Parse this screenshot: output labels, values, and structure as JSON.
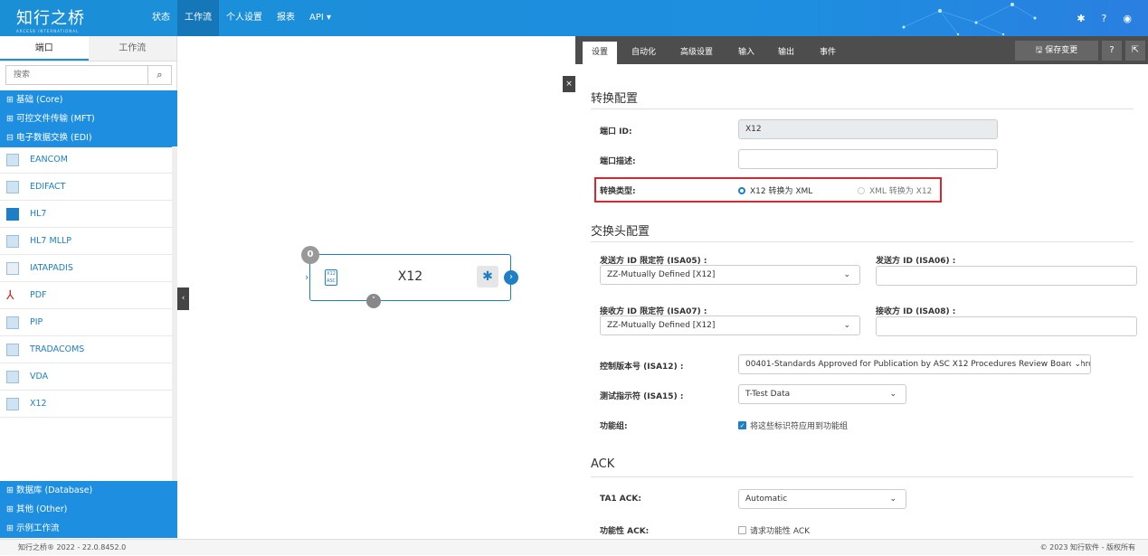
{
  "header": {
    "logo": "知行之桥",
    "logo_sub": "ARCESB INTERNATIONAL",
    "nav": [
      "状态",
      "工作流",
      "个人设置",
      "报表",
      "API ▾"
    ],
    "active_nav": 1
  },
  "sidebar": {
    "tabs": [
      "端口",
      "工作流"
    ],
    "search_placeholder": "搜索",
    "groups": {
      "core": "⊞ 基础 (Core)",
      "mft": "⊞ 可控文件传输 (MFT)",
      "edi": "⊟ 电子数据交换 (EDI)",
      "database": "⊞ 数据库 (Database)",
      "other": "⊞ 其他 (Other)",
      "examples": "⊞ 示例工作流"
    },
    "ports": [
      "EANCOM",
      "EDIFACT",
      "HL7",
      "HL7 MLLP",
      "IATAPADIS",
      "PDF",
      "PIP",
      "TRADACOMS",
      "VDA",
      "X12"
    ]
  },
  "canvas": {
    "node_title": "X12",
    "node_badge": "0",
    "node_icon_text": "X12 ASC"
  },
  "panel": {
    "tabs": [
      "设置",
      "自动化",
      "高级设置",
      "输入",
      "输出",
      "事件"
    ],
    "save_label": "🖫 保存变更",
    "sections": {
      "translation": "转换配置",
      "interchange": "交换头配置",
      "ack": "ACK"
    },
    "fields": {
      "port_id_label": "端口 ID:",
      "port_id_value": "X12",
      "port_desc_label": "端口描述:",
      "type_label": "转换类型:",
      "radio_x12_xml": "X12 转换为 XML",
      "radio_xml_x12": "XML 转换为 X12",
      "sender_qual_label": "发送方 ID 限定符 (ISA05) :",
      "sender_qual_value": "ZZ-Mutually Defined [X12]",
      "sender_id_label": "发送方 ID (ISA06) :",
      "receiver_qual_label": "接收方 ID 限定符 (ISA07) :",
      "receiver_qual_value": "ZZ-Mutually Defined [X12]",
      "receiver_id_label": "接收方 ID (ISA08) :",
      "control_version_label": "控制版本号 (ISA12) :",
      "control_version_value": "00401-Standards Approved for Publication by ASC X12 Procedures Review Board throu",
      "test_indicator_label": "测试指示符 (ISA15) :",
      "test_indicator_value": "T-Test Data",
      "func_group_label": "功能组:",
      "func_group_check": "将这些标识符应用到功能组",
      "ta1_label": "TA1 ACK:",
      "ta1_value": "Automatic",
      "func_ack_label": "功能性 ACK:",
      "func_ack_check": "请求功能性 ACK"
    }
  },
  "footer": {
    "left": "知行之桥® 2022 - 22.0.8452.0",
    "right": "© 2023 知行软件 - 版权所有"
  }
}
